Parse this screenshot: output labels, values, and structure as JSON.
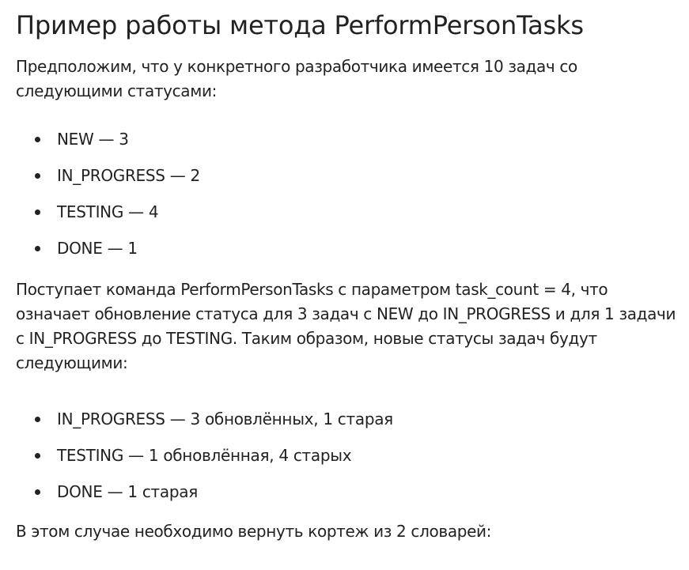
{
  "article": {
    "title": "Пример работы метода PerformPersonTasks",
    "intro": "Предположим, что у конкретного разработчика имеется 10 задач со следующими статусами:",
    "initial_statuses": [
      "NEW — 3",
      "IN_PROGRESS — 2",
      "TESTING — 4",
      "DONE — 1"
    ],
    "command_text": "Поступает команда PerformPersonTasks с параметром task_count = 4, что означает обновление статуса для 3 задач с NEW до IN_PROGRESS и для 1 задачи с IN_PROGRESS до TESTING. Таким образом, новые статусы задач будут следующими:",
    "new_statuses": [
      "IN_PROGRESS — 3 обновлённых, 1 старая",
      "TESTING — 1 обновлённая, 4 старых",
      "DONE — 1 старая"
    ],
    "conclusion": "В этом случае необходимо вернуть кортеж из 2 словарей:"
  }
}
